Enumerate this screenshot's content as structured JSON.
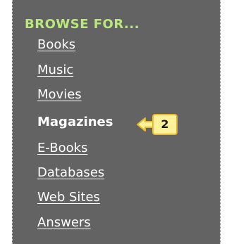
{
  "sidebar": {
    "title": "BROWSE FOR...",
    "items": [
      {
        "label": "Books",
        "current": false
      },
      {
        "label": "Music",
        "current": false
      },
      {
        "label": "Movies",
        "current": false
      },
      {
        "label": "Magazines",
        "current": true
      },
      {
        "label": "E-Books",
        "current": false
      },
      {
        "label": "Databases",
        "current": false
      },
      {
        "label": "Web Sites",
        "current": false
      },
      {
        "label": "Answers",
        "current": false
      }
    ]
  },
  "callout": {
    "step": "2",
    "icon": "arrow-left-icon"
  },
  "colors": {
    "panel_bg": "#636363",
    "title": "#b9e87a",
    "link": "#ffffff",
    "callout_fill": "#fff29a",
    "callout_border": "#e8b92d"
  }
}
